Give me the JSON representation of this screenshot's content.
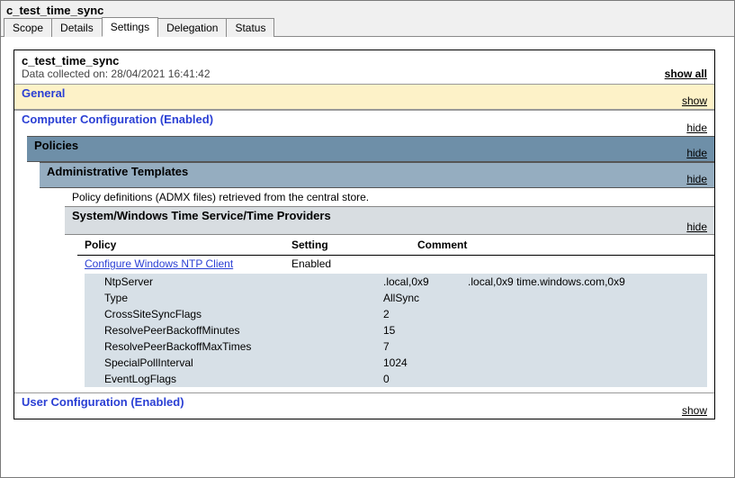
{
  "window_title": "c_test_time_sync",
  "tabs": {
    "scope": "Scope",
    "details": "Details",
    "settings": "Settings",
    "delegation": "Delegation",
    "status": "Status"
  },
  "report": {
    "title": "c_test_time_sync",
    "collected_prefix": "Data collected on: ",
    "collected_date": "28/04/2021 16:41:42",
    "show_all": "show all"
  },
  "sections": {
    "general": {
      "label": "General",
      "toggle": "show"
    },
    "comp_conf": {
      "label": "Computer Configuration (Enabled)",
      "toggle": "hide"
    },
    "policies": {
      "label": "Policies",
      "toggle": "hide"
    },
    "admin_tmpl": {
      "label": "Administrative Templates",
      "toggle": "hide"
    },
    "admx_note": "Policy definitions (ADMX files) retrieved from the central store.",
    "path": {
      "label": "System/Windows Time Service/Time Providers",
      "toggle": "hide"
    },
    "user_conf": {
      "label": "User Configuration (Enabled)",
      "toggle": "show"
    }
  },
  "policy_table": {
    "headers": {
      "policy": "Policy",
      "setting": "Setting",
      "comment": "Comment"
    },
    "row": {
      "policy": "Configure Windows NTP Client",
      "setting": "Enabled",
      "comment": ""
    },
    "details": {
      "NtpServer": ".local,0x9             .local,0x9 time.windows.com,0x9",
      "Type": "AllSync",
      "CrossSiteSyncFlags": "2",
      "ResolvePeerBackoffMinutes": "15",
      "ResolvePeerBackoffMaxTimes": "7",
      "SpecialPollInterval": "1024",
      "EventLogFlags": "0"
    }
  }
}
